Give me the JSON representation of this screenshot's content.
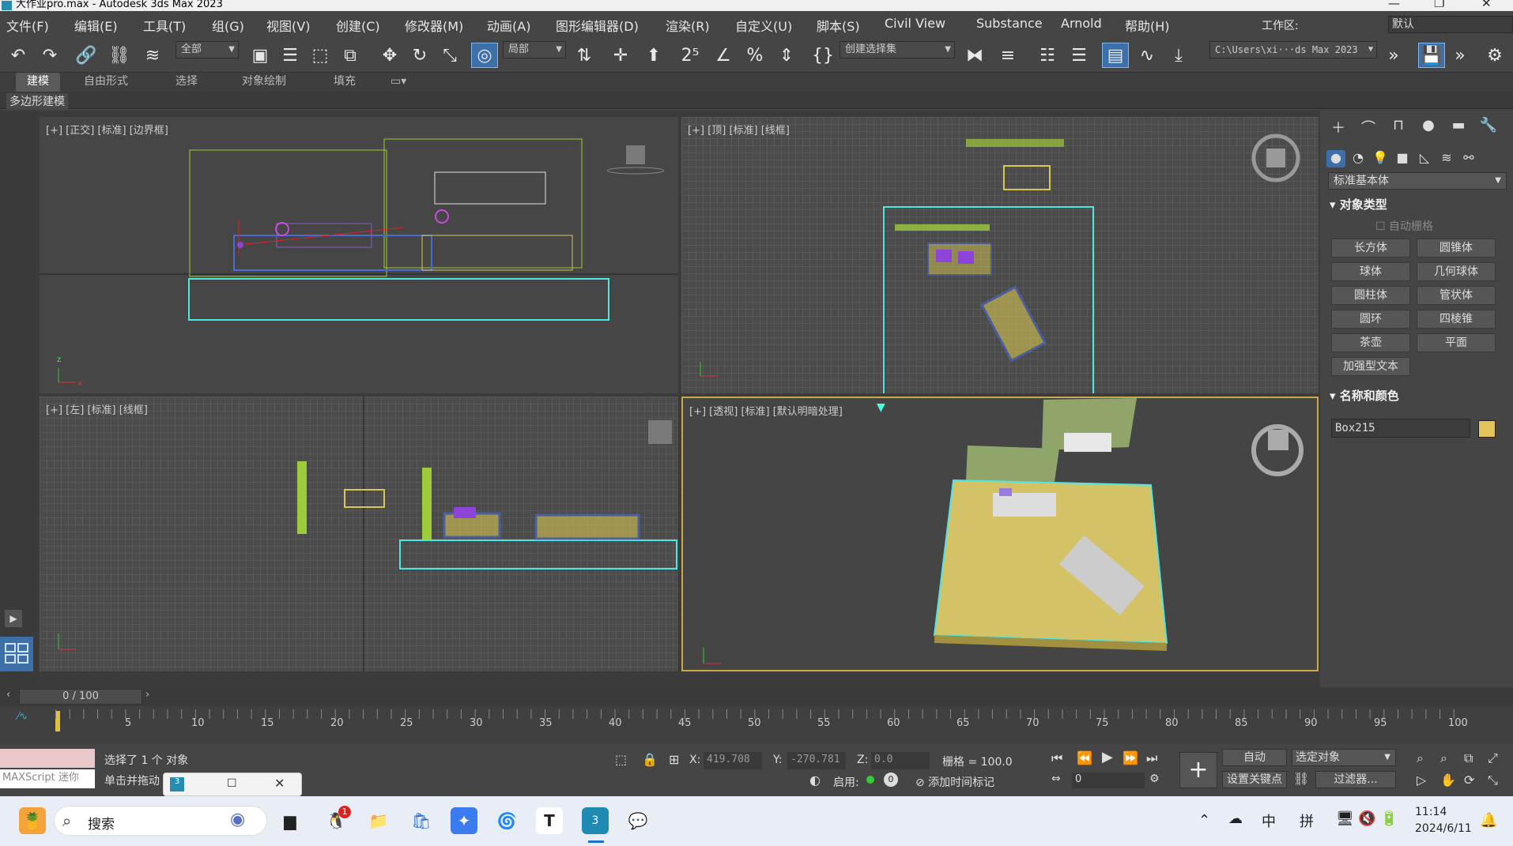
{
  "window": {
    "title": "大作业pro.max - Autodesk 3ds Max 2023"
  },
  "menu": [
    "文件(F)",
    "编辑(E)",
    "工具(T)",
    "组(G)",
    "视图(V)",
    "创建(C)",
    "修改器(M)",
    "动画(A)",
    "图形编辑器(D)",
    "渲染(R)",
    "自定义(U)",
    "脚本(S)",
    "Civil View",
    "Substance",
    "Arnold",
    "帮助(H)"
  ],
  "workspace": {
    "label": "工作区:",
    "value": "默认"
  },
  "toolbar": {
    "filter": "全部",
    "coord": "局部",
    "selection_set": "创建选择集",
    "path": "C:\\Users\\xi···ds Max 2023"
  },
  "ribbon": {
    "tabs": [
      "建模",
      "自由形式",
      "选择",
      "对象绘制",
      "填充"
    ],
    "active": "建模",
    "sub": "多边形建模"
  },
  "viewports": {
    "front": "[+] [正交] [标准] [边界框]",
    "top": "[+] [顶] [标准] [线框]",
    "left": "[+] [左] [标准] [线框]",
    "persp": "[+] [透视] [标准] [默认明暗处理]"
  },
  "command_panel": {
    "dropdown": "标准基本体",
    "object_type_header": "对象类型",
    "autogrid": "自动栅格",
    "buttons": [
      "长方体",
      "圆锥体",
      "球体",
      "几何球体",
      "圆柱体",
      "管状体",
      "圆环",
      "四棱锥",
      "茶壶",
      "平面",
      "加强型文本"
    ],
    "name_color_header": "名称和颜色",
    "object_name": "Box215",
    "object_color": "#e2c45a"
  },
  "timeline": {
    "frame": "0 / 100",
    "ticks": [
      "5",
      "10",
      "15",
      "20",
      "25",
      "30",
      "35",
      "40",
      "45",
      "50",
      "55",
      "60",
      "65",
      "70",
      "75",
      "80",
      "85",
      "90",
      "95",
      "100"
    ]
  },
  "status": {
    "selected": "选择了 1 个 对象",
    "hint": "单击并拖动",
    "maxscript": "MAXScript 迷你",
    "x_label": "X:",
    "x": "419.708",
    "y_label": "Y:",
    "y": "-270.781",
    "z_label": "Z:",
    "z": "0.0",
    "grid": "栅格 = 100.0",
    "enable": "启用:",
    "add_time_tag": "添加时间标记",
    "auto": "自动",
    "selected_obj": "选定对象",
    "set_key": "设置关键点",
    "filter": "过滤器...",
    "frame_field": "0"
  },
  "taskbar": {
    "search": "搜索",
    "badge": "1",
    "time": "11:14",
    "date": "2024/6/11",
    "ime1": "中",
    "ime2": "拼"
  }
}
